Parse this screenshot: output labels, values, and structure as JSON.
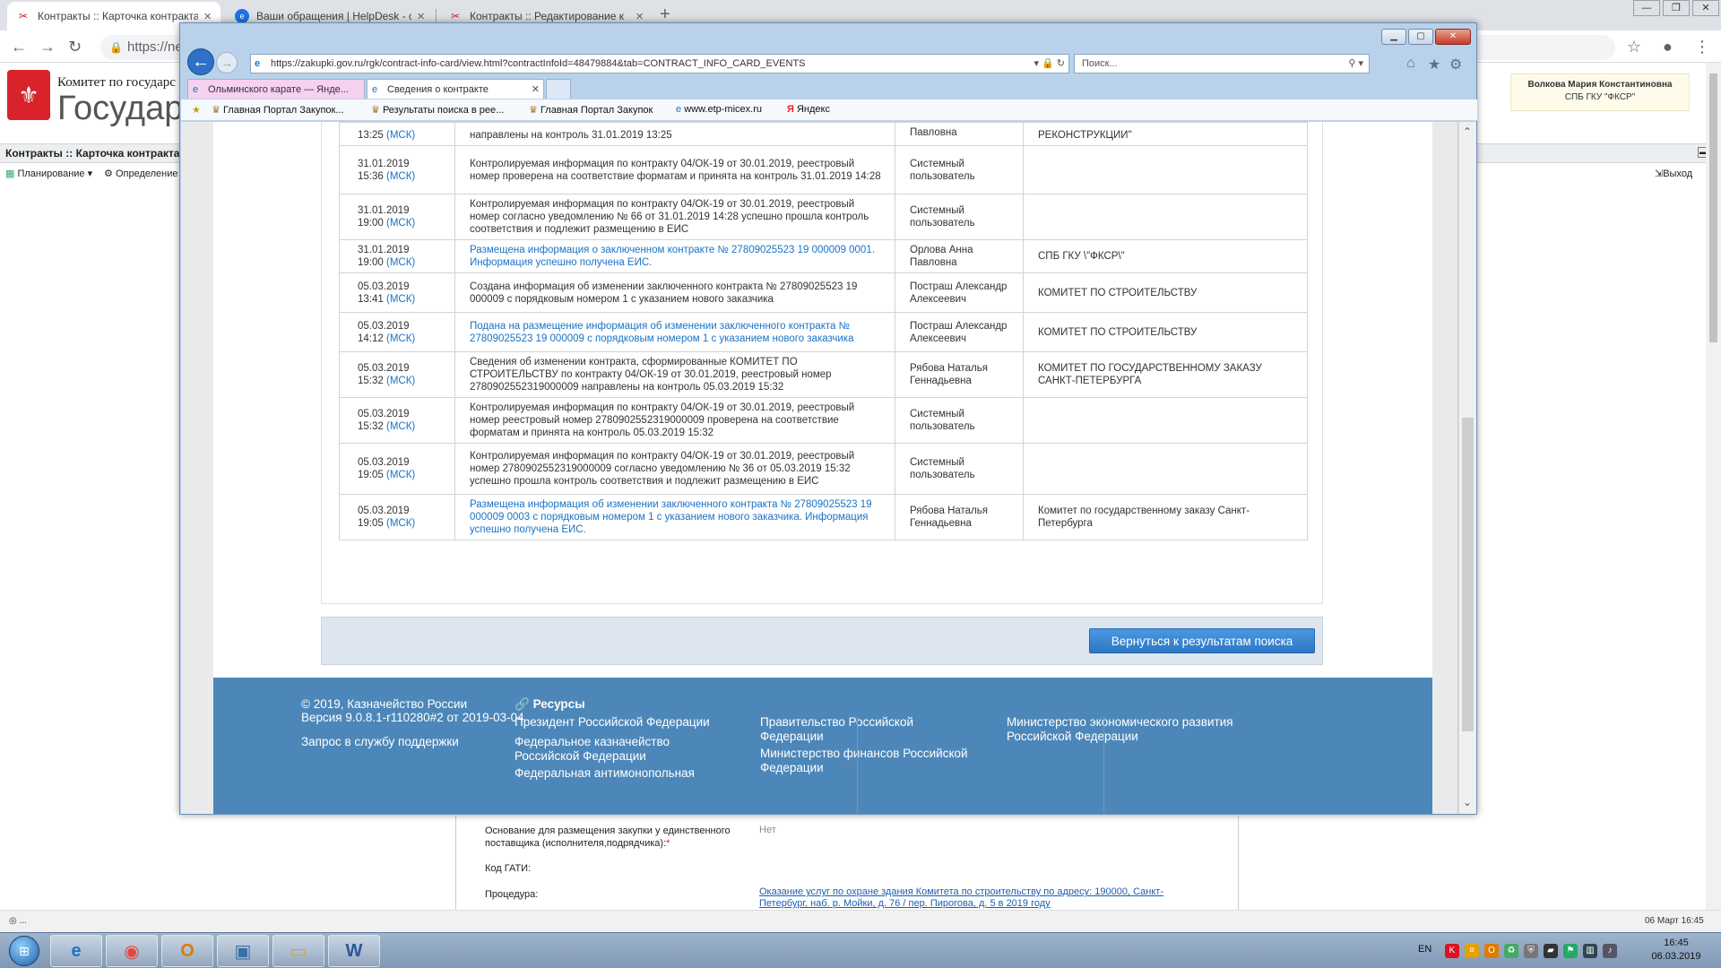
{
  "chrome": {
    "tabs": [
      {
        "title": "Контракты :: Карточка контракта"
      },
      {
        "title": "Ваши обращения | HelpDesk - с"
      },
      {
        "title": "Контракты :: Редактирование к"
      }
    ],
    "url_fragment": "https://ne"
  },
  "portal": {
    "committee": "Комитет по государс",
    "title": "Государ",
    "user_name": "Волкова Мария Константиновна",
    "user_org": "СПБ ГКУ \"ФКСР\"",
    "breadcrumb": "Контракты :: Карточка контракта",
    "menu_planning": "Планирование",
    "menu_definition": "Определение",
    "menu_exit": "Выход",
    "form": {
      "basis_label": "Основание для размещения закупки у единственного поставщика (исполнителя,подрядчика):",
      "basis_required": "*",
      "basis_value": "Нет",
      "gati_label": "Код ГАТИ:",
      "procedure_label": "Процедура:",
      "procedure_value": "Оказание услуг по охране здания Комитета по строительству по адресу: 190000, Санкт-Петербург, наб. р. Мойки, д. 76 / пер. Пирогова, д. 5 в 2019 году"
    },
    "status_left": "◎ ...",
    "status_right": "06 Март 16:45"
  },
  "ie": {
    "address": "https://zakupki.gov.ru/rgk/contract-info-card/view.html?contractInfoId=48479884&tab=CONTRACT_INFO_CARD_EVENTS",
    "search_placeholder": "Поиск...",
    "tabs": [
      {
        "title": "Ольминского карате — Янде..."
      },
      {
        "title": "Сведения о контракте"
      }
    ],
    "favorites": [
      "Главная Портал Закупок...",
      "Результаты поиска в рее...",
      "Главная Портал Закупок",
      "www.etp-micex.ru",
      "Яндекс"
    ]
  },
  "events": {
    "partial_row": {
      "time": "13:25",
      "tz": "(МСК)",
      "desc": "направлены на контроль 31.01.2019 13:25",
      "user": "Павловна",
      "org": "РЕКОНСТРУКЦИИ\""
    },
    "rows": [
      {
        "date": "31.01.2019",
        "time": "15:36",
        "tz": "(МСК)",
        "desc": "Контролируемая информация по контракту 04/ОК-19 от 30.01.2019, реестровый номер проверена на соответствие форматам и принята на контроль 31.01.2019 14:28",
        "is_link": false,
        "user": "Системный пользователь",
        "org": ""
      },
      {
        "date": "31.01.2019",
        "time": "19:00",
        "tz": "(МСК)",
        "desc": "Контролируемая информация по контракту 04/ОК-19 от 30.01.2019, реестровый номер согласно уведомлению № 66 от 31.01.2019 14:28 успешно прошла контроль соответствия и подлежит размещению в ЕИС",
        "is_link": false,
        "user": "Системный пользователь",
        "org": ""
      },
      {
        "date": "31.01.2019",
        "time": "19:00",
        "tz": "(МСК)",
        "desc": "Размещена информация о заключенном контракте № 27809025523 19 000009 0001. Информация успешно получена ЕИС.",
        "is_link": true,
        "user": "Орлова Анна Павловна",
        "org": "СПБ ГКУ \\\"ФКСР\\\""
      },
      {
        "date": "05.03.2019",
        "time": "13:41",
        "tz": "(МСК)",
        "desc": "Создана информация об изменении заключенного контракта № 27809025523 19 000009 с порядковым номером 1 с указанием нового заказчика",
        "is_link": false,
        "user": "Пострaш Александр Алексеевич",
        "org": "КОМИТЕТ ПО СТРОИТЕЛЬСТВУ"
      },
      {
        "date": "05.03.2019",
        "time": "14:12",
        "tz": "(МСК)",
        "desc": "Подана на размещение информация об изменении заключенного контракта № 27809025523 19 000009 с порядковым номером 1 с указанием нового заказчика",
        "is_link": true,
        "user": "Пострaш Александр Алексеевич",
        "org": "КОМИТЕТ ПО СТРОИТЕЛЬСТВУ"
      },
      {
        "date": "05.03.2019",
        "time": "15:32",
        "tz": "(МСК)",
        "desc": "Сведения об изменении контракта, сформированные КОМИТЕТ ПО СТРОИТЕЛЬСТВУ по контракту 04/ОК-19 от 30.01.2019, реестровый номер 2780902552319000009 направлены на контроль 05.03.2019 15:32",
        "is_link": false,
        "user": "Рябова Наталья Геннадьевна",
        "org": "КОМИТЕТ ПО ГОСУДАРСТВЕННОМУ ЗАКАЗУ САНКТ-ПЕТЕРБУРГА"
      },
      {
        "date": "05.03.2019",
        "time": "15:32",
        "tz": "(МСК)",
        "desc": "Контролируемая информация по контракту 04/ОК-19 от 30.01.2019, реестровый номер реестровый номер 2780902552319000009 проверена на соответствие форматам и принята на контроль 05.03.2019 15:32",
        "is_link": false,
        "user": "Системный пользователь",
        "org": ""
      },
      {
        "date": "05.03.2019",
        "time": "19:05",
        "tz": "(МСК)",
        "desc": "Контролируемая информация по контракту 04/ОК-19 от 30.01.2019, реестровый номер 2780902552319000009 согласно уведомлению № 36 от 05.03.2019 15:32 успешно прошла контроль соответствия и подлежит размещению в ЕИС",
        "is_link": false,
        "user": "Системный пользователь",
        "org": ""
      },
      {
        "date": "05.03.2019",
        "time": "19:05",
        "tz": "(МСК)",
        "desc": "Размещена информация об изменении заключенного контракта № 27809025523 19 000009 0003 с порядковым номером 1 с указанием нового заказчика. Информация успешно получена ЕИС.",
        "is_link": true,
        "user": "Рябова Наталья Геннадьевна",
        "org": "Комитет по государственному заказу Санкт-Петербурга"
      }
    ],
    "back_button": "Вернуться к результатам поиска"
  },
  "footer": {
    "copyright": "© 2019, Казначейство России",
    "version": "Версия 9.0.8.1-r110280#2 от 2019-03-04",
    "support": "Запрос в службу поддержки",
    "resources_title": "Ресурсы",
    "links": [
      "Президент Российской Федерации",
      "Правительство Российской Федерации",
      "Министерство экономического развития Российской Федерации",
      "Федеральное казначейство Российской Федерации",
      "Министерство финансов Российской Федерации",
      "Федеральная антимонопольная"
    ]
  },
  "taskbar": {
    "lang": "EN",
    "time": "16:45",
    "date": "06.03.2019"
  },
  "colors": {
    "link_blue": "#1a73c5",
    "footer_blue": "#4d87b9",
    "button_blue": "#2b77c6"
  }
}
